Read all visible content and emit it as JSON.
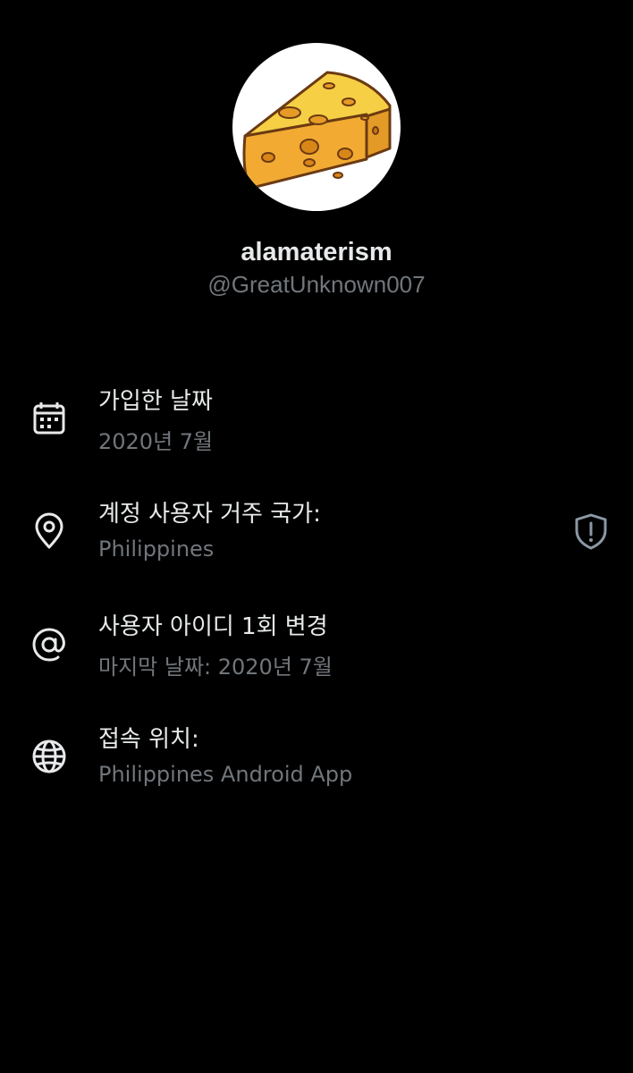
{
  "profile": {
    "display_name": "alamaterism",
    "handle": "@GreatUnknown007",
    "avatar_icon": "cheese-wedge"
  },
  "rows": [
    {
      "icon": "calendar-icon",
      "title": "가입한 날짜",
      "value": "2020년 7월"
    },
    {
      "icon": "location-pin-icon",
      "title": "계정 사용자 거주 국가:",
      "value": "Philippines",
      "trailing_icon": "shield-alert-icon"
    },
    {
      "icon": "at-sign-icon",
      "title": "사용자 아이디 1회 변경",
      "value": "마지막 날짜: 2020년 7월"
    },
    {
      "icon": "globe-icon",
      "title": "접속 위치:",
      "value": "Philippines Android App"
    }
  ],
  "colors": {
    "background": "#000000",
    "primary_text": "#e7e9ea",
    "secondary_text": "#71767b",
    "cheese": "#f7b733"
  }
}
